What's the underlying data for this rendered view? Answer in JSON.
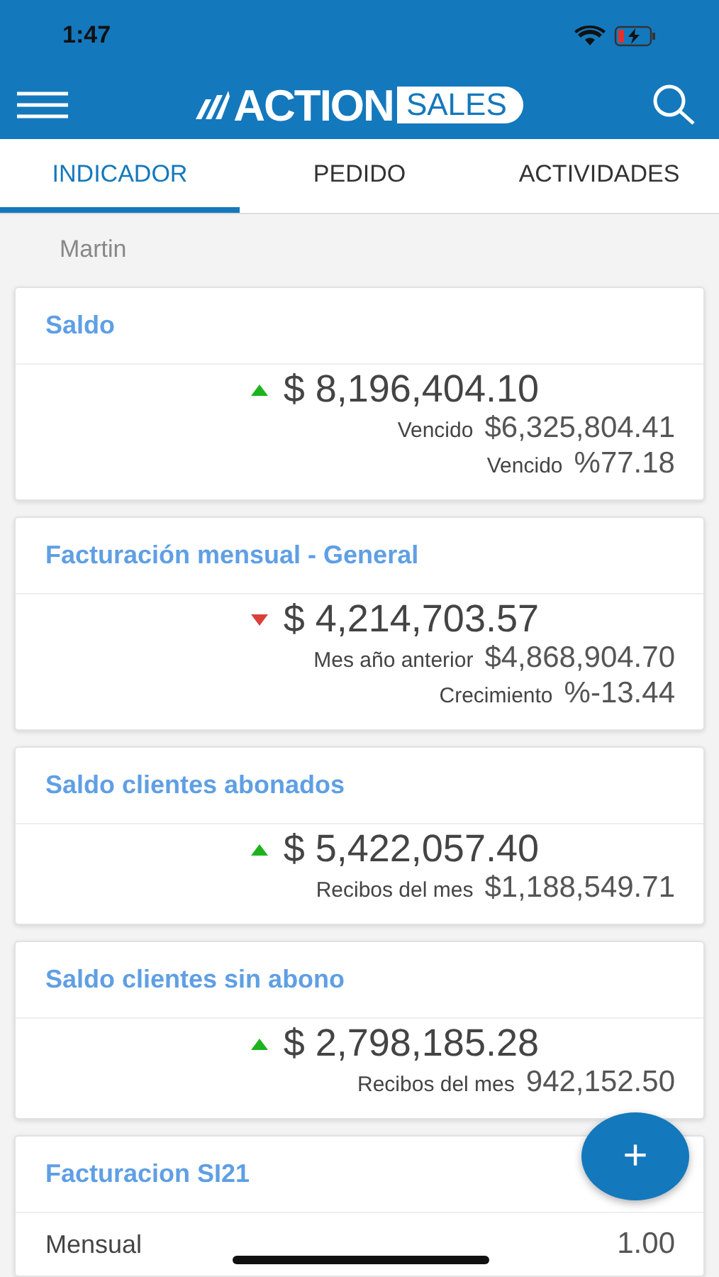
{
  "status_bar": {
    "time": "1:47"
  },
  "header": {
    "logo_primary": "ACTION",
    "logo_secondary": "SALES"
  },
  "tabs": [
    {
      "label": "INDICADOR",
      "selected": true
    },
    {
      "label": "PEDIDO",
      "selected": false
    },
    {
      "label": "ACTIVIDADES",
      "selected": false
    }
  ],
  "user": "Martin",
  "cards": [
    {
      "kind": "indicator",
      "title": "Saldo",
      "rising": true,
      "amount": "$ 8,196,404.10",
      "details": [
        {
          "label": "Vencido",
          "value": "$6,325,804.41"
        },
        {
          "label": "Vencido",
          "value": "%77.18"
        }
      ]
    },
    {
      "kind": "indicator",
      "title": "Facturación mensual - General",
      "rising": false,
      "amount": "$ 4,214,703.57",
      "details": [
        {
          "label": "Mes año anterior",
          "value": "$4,868,904.70"
        },
        {
          "label": "Crecimiento",
          "value": "%-13.44"
        }
      ]
    },
    {
      "kind": "indicator",
      "title": "Saldo clientes abonados",
      "rising": true,
      "amount": "$ 5,422,057.40",
      "details": [
        {
          "label": "Recibos del mes",
          "value": "$1,188,549.71"
        }
      ]
    },
    {
      "kind": "indicator",
      "title": "Saldo clientes sin abono",
      "rising": true,
      "amount": "$ 2,798,185.28",
      "details": [
        {
          "label": "Recibos del mes",
          "value": "942,152.50"
        }
      ]
    },
    {
      "kind": "list",
      "title": "Facturacion SI21",
      "rows": [
        {
          "label": "Mensual",
          "value": "1.00"
        }
      ]
    }
  ],
  "fab": {
    "label": "+"
  }
}
